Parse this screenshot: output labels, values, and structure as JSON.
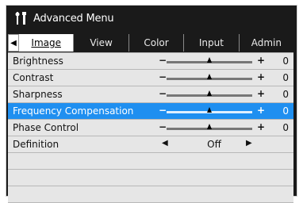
{
  "window": {
    "title": "Advanced Menu",
    "icon": "tools-icon"
  },
  "tabs": [
    {
      "label": "Image",
      "active": true
    },
    {
      "label": "View",
      "active": false
    },
    {
      "label": "Color",
      "active": false
    },
    {
      "label": "Input",
      "active": false
    },
    {
      "label": "Admin",
      "active": false
    }
  ],
  "items": [
    {
      "label": "Brightness",
      "type": "slider",
      "value": "0",
      "level": 0.5
    },
    {
      "label": "Contrast",
      "type": "slider",
      "value": "0",
      "level": 0.5
    },
    {
      "label": "Sharpness",
      "type": "slider",
      "value": "0",
      "level": 0.5
    },
    {
      "label": "Frequency Compensation",
      "type": "slider",
      "value": "0",
      "level": 0.5,
      "selected": true
    },
    {
      "label": "Phase Control",
      "type": "slider",
      "value": "0",
      "level": 0.5
    },
    {
      "label": "Definition",
      "type": "option",
      "value": "Off"
    }
  ],
  "empty_rows": 3,
  "colors": {
    "window_bg": "#1a1a1a",
    "row_bg": "#e6e6e6",
    "selected_bg": "#1f8ff0"
  }
}
